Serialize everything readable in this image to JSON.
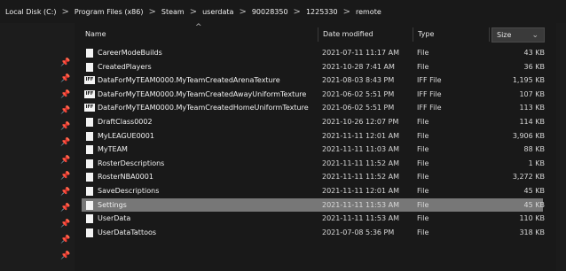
{
  "breadcrumb": [
    "Local Disk (C:)",
    "Program Files (x86)",
    "Steam",
    "userdata",
    "90028350",
    "1225330",
    "remote"
  ],
  "breadcrumb_separator": ">",
  "columns": {
    "name": "Name",
    "date": "Date modified",
    "type": "Type",
    "size": "Size"
  },
  "icons": {
    "pin": "📌",
    "sort_up": "^",
    "sort_dropdown": "⌄"
  },
  "files": [
    {
      "name": "CareerModeBuilds",
      "date": "2021-07-11 11:17 AM",
      "type": "File",
      "size": "43 KB",
      "icon": "file-icon"
    },
    {
      "name": "CreatedPlayers",
      "date": "2021-10-28 7:41 AM",
      "type": "File",
      "size": "36 KB",
      "icon": "file-icon"
    },
    {
      "name": "DataForMyTEAM0000.MyTeamCreatedArenaTexture",
      "date": "2021-08-03 8:43 PM",
      "type": "IFF File",
      "size": "1,195 KB",
      "icon": "iff-icon"
    },
    {
      "name": "DataForMyTEAM0000.MyTeamCreatedAwayUniformTexture",
      "date": "2021-06-02 5:51 PM",
      "type": "IFF File",
      "size": "107 KB",
      "icon": "iff-icon"
    },
    {
      "name": "DataForMyTEAM0000.MyTeamCreatedHomeUniformTexture",
      "date": "2021-06-02 5:51 PM",
      "type": "IFF File",
      "size": "113 KB",
      "icon": "iff-icon"
    },
    {
      "name": "DraftClass0002",
      "date": "2021-10-26 12:07 PM",
      "type": "File",
      "size": "114 KB",
      "icon": "file-icon"
    },
    {
      "name": "MyLEAGUE0001",
      "date": "2021-11-11 12:01 AM",
      "type": "File",
      "size": "3,906 KB",
      "icon": "file-icon"
    },
    {
      "name": "MyTEAM",
      "date": "2021-11-11 11:03 AM",
      "type": "File",
      "size": "88 KB",
      "icon": "file-icon"
    },
    {
      "name": "RosterDescriptions",
      "date": "2021-11-11 11:52 AM",
      "type": "File",
      "size": "1 KB",
      "icon": "file-icon"
    },
    {
      "name": "RosterNBA0001",
      "date": "2021-11-11 11:52 AM",
      "type": "File",
      "size": "3,272 KB",
      "icon": "file-icon"
    },
    {
      "name": "SaveDescriptions",
      "date": "2021-11-11 12:01 AM",
      "type": "File",
      "size": "45 KB",
      "icon": "file-icon"
    },
    {
      "name": "Settings",
      "date": "2021-11-11 11:53 AM",
      "type": "File",
      "size": "45 KB",
      "icon": "file-icon",
      "selected": true
    },
    {
      "name": "UserData",
      "date": "2021-11-11 11:53 AM",
      "type": "File",
      "size": "110 KB",
      "icon": "file-icon"
    },
    {
      "name": "UserDataTattoos",
      "date": "2021-07-08 5:36 PM",
      "type": "File",
      "size": "318 KB",
      "icon": "file-icon"
    }
  ]
}
